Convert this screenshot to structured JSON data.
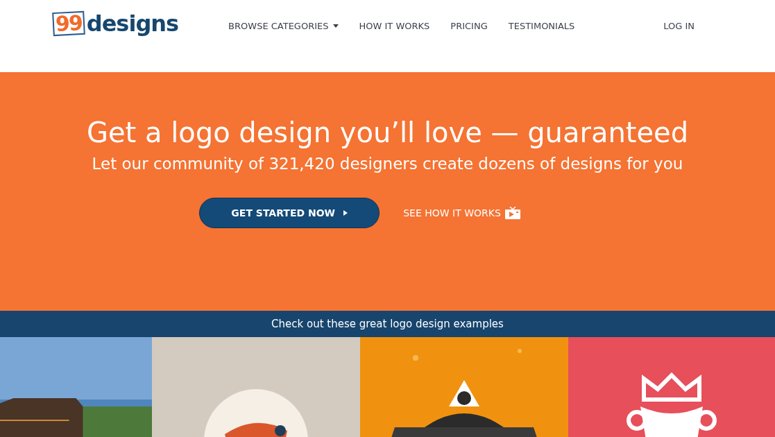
{
  "header": {
    "logo": {
      "mark": "99",
      "wordmark": "designs"
    },
    "nav": [
      {
        "label": "BROWSE CATEGORIES",
        "dropdown": true
      },
      {
        "label": "HOW IT WORKS",
        "dropdown": false
      },
      {
        "label": "PRICING",
        "dropdown": false
      },
      {
        "label": "TESTIMONIALS",
        "dropdown": false
      }
    ],
    "login": "LOG IN"
  },
  "hero": {
    "title": "Get a logo design you’ll love — guaranteed",
    "subtitle": "Let our community of 321,420 designers create dozens of designs for you",
    "primary_button": "GET STARTED NOW",
    "secondary_link": "SEE HOW IT WORKS"
  },
  "examples": {
    "heading": "Check out these great logo design examples"
  }
}
